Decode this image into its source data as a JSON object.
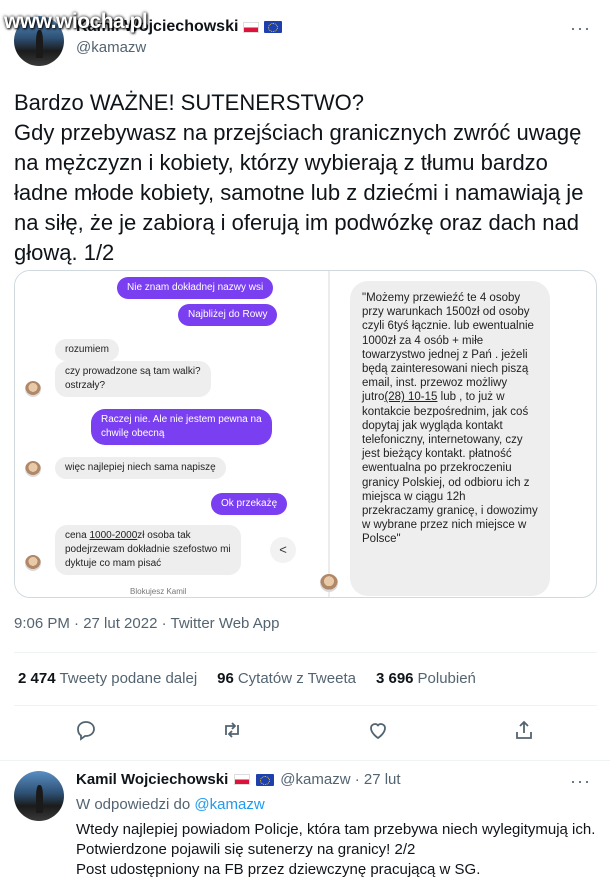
{
  "watermark": "www.wiocha.pl",
  "tweet1": {
    "author_name": "Kamil Wojciechowski",
    "handle": "@kamazw",
    "text": "Bardzo WAŻNE! SUTENERSTWO?\nGdy przebywasz na przejściach granicznych zwróć uwagę na mężczyzn i kobiety, którzy wybierają z tłumu bardzo ładne młode kobiety, samotne lub z dziećmi i namawiają je na siłę, że je zabiorą i oferują im podwózkę oraz dach nad głową. 1/2",
    "meta": "9:06 PM · 27 lut 2022 · Twitter Web App",
    "stats": {
      "retweets_count": "2 474",
      "retweets_label": "Tweety podane dalej",
      "quotes_count": "96",
      "quotes_label": "Cytatów z Tweeta",
      "likes_count": "3 696",
      "likes_label": "Polubień"
    },
    "actions": [
      "reply-icon",
      "retweet-icon",
      "like-icon",
      "share-icon"
    ]
  },
  "media": {
    "chat": {
      "msg1": "Nie znam dokładnej nazwy wsi",
      "msg2": "Najbliżej do Rowy",
      "msg3": "rozumiem",
      "msg4": "czy prowadzone są tam walki?\nostrzały?",
      "msg5": "Raczej nie. Ale nie jestem pewna na\nchwilę obecną",
      "msg6": "więc najlepiej niech sama napiszę",
      "msg7": "Ok przekażę",
      "msg8_pre": "cena ",
      "msg8_price": "1000-2000",
      "msg8_post": "zł osoba tak\npodejrzewam dokładnie szefostwo mi\ndyktuje co mam pisać",
      "blocked": "Blokujesz Kamil"
    },
    "right_bubble_pre": "\"Możemy przewieźć te 4 osoby przy warunkach 1500zł od osoby czyli 6tyś łącznie.  lub ewentualnie 1000zł za 4 osób + miłe towarzystwo jednej z Pań . jeżeli będą zainteresowani niech piszą email, inst. przewoz możliwy jutro",
    "right_bubble_date": "(28) 10-15",
    "right_bubble_post": " lub , to już w kontakcie bezpośrednim, jak coś dopytaj jak wygląda kontakt telefoniczny, internetowany, czy jest bieżący kontakt. płatność ewentualna po przekroczeniu granicy Polskiej, od odbioru ich z miejsca w ciągu 12h przekraczamy granicę, i dowozimy w wybrane przez nich miejsce w Polsce\""
  },
  "tweet2": {
    "author_name": "Kamil Wojciechowski",
    "handle_time": "@kamazw · 27 lut",
    "reply_prefix": "W odpowiedzi do",
    "reply_handle": "@kamazw",
    "text": "Wtedy najlepiej powiadom Policje, która tam przebywa niech wylegitymują ich. Potwierdzone pojawili się sutenerzy na granicy! 2/2\nPost udostępniony na FB przez dziewczynę pracującą w SG."
  }
}
